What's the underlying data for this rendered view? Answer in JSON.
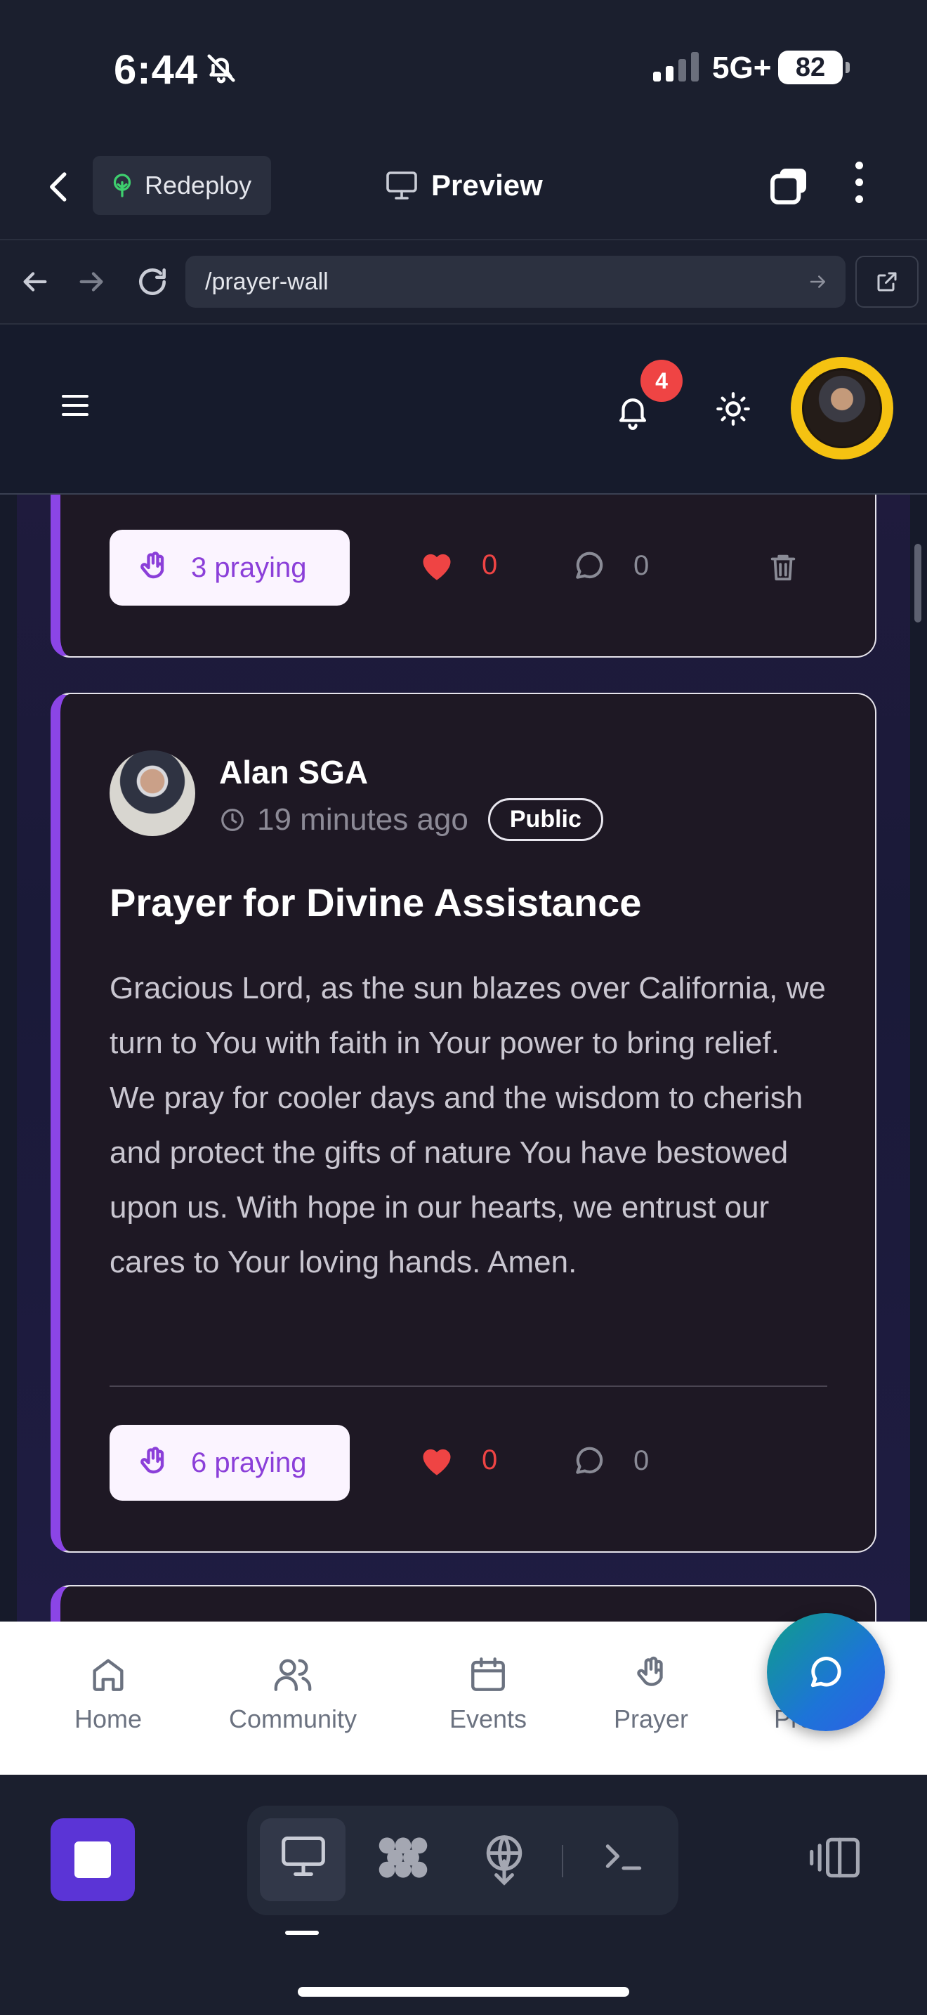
{
  "status_bar": {
    "time": "6:44",
    "network": "5G+",
    "battery": "82"
  },
  "app_header": {
    "redeploy_label": "Redeploy",
    "preview_label": "Preview"
  },
  "url_bar": {
    "url": "/prayer-wall"
  },
  "site_header": {
    "notification_count": "4"
  },
  "posts": [
    {
      "praying_label": "3 praying",
      "likes": "0",
      "comments": "0"
    },
    {
      "author": "Alan SGA",
      "time_ago": "19 minutes ago",
      "visibility": "Public",
      "title": "Prayer for Divine Assistance",
      "body": "Gracious Lord, as the sun blazes over California, we turn to You with faith in Your power to bring relief. We pray for cooler days and the wisdom to cherish and protect the gifts of nature You have bestowed upon us. With hope in our hearts, we entrust our cares to Your loving hands. Amen.",
      "praying_label": "6 praying",
      "likes": "0",
      "comments": "0"
    }
  ],
  "bottom_nav": {
    "items": [
      {
        "label": "Home",
        "icon": "home-icon"
      },
      {
        "label": "Community",
        "icon": "users-icon"
      },
      {
        "label": "Events",
        "icon": "calendar-icon"
      },
      {
        "label": "Prayer",
        "icon": "hand-icon"
      },
      {
        "label": "Profile",
        "icon": "user-icon"
      }
    ]
  },
  "colors": {
    "accent_purple": "#8b45e6",
    "like_red": "#ef4444",
    "avatar_ring": "#f5c211",
    "fab_start": "#0f9e8a",
    "fab_end": "#2f5fe6",
    "stop_button": "#5b34d6"
  }
}
